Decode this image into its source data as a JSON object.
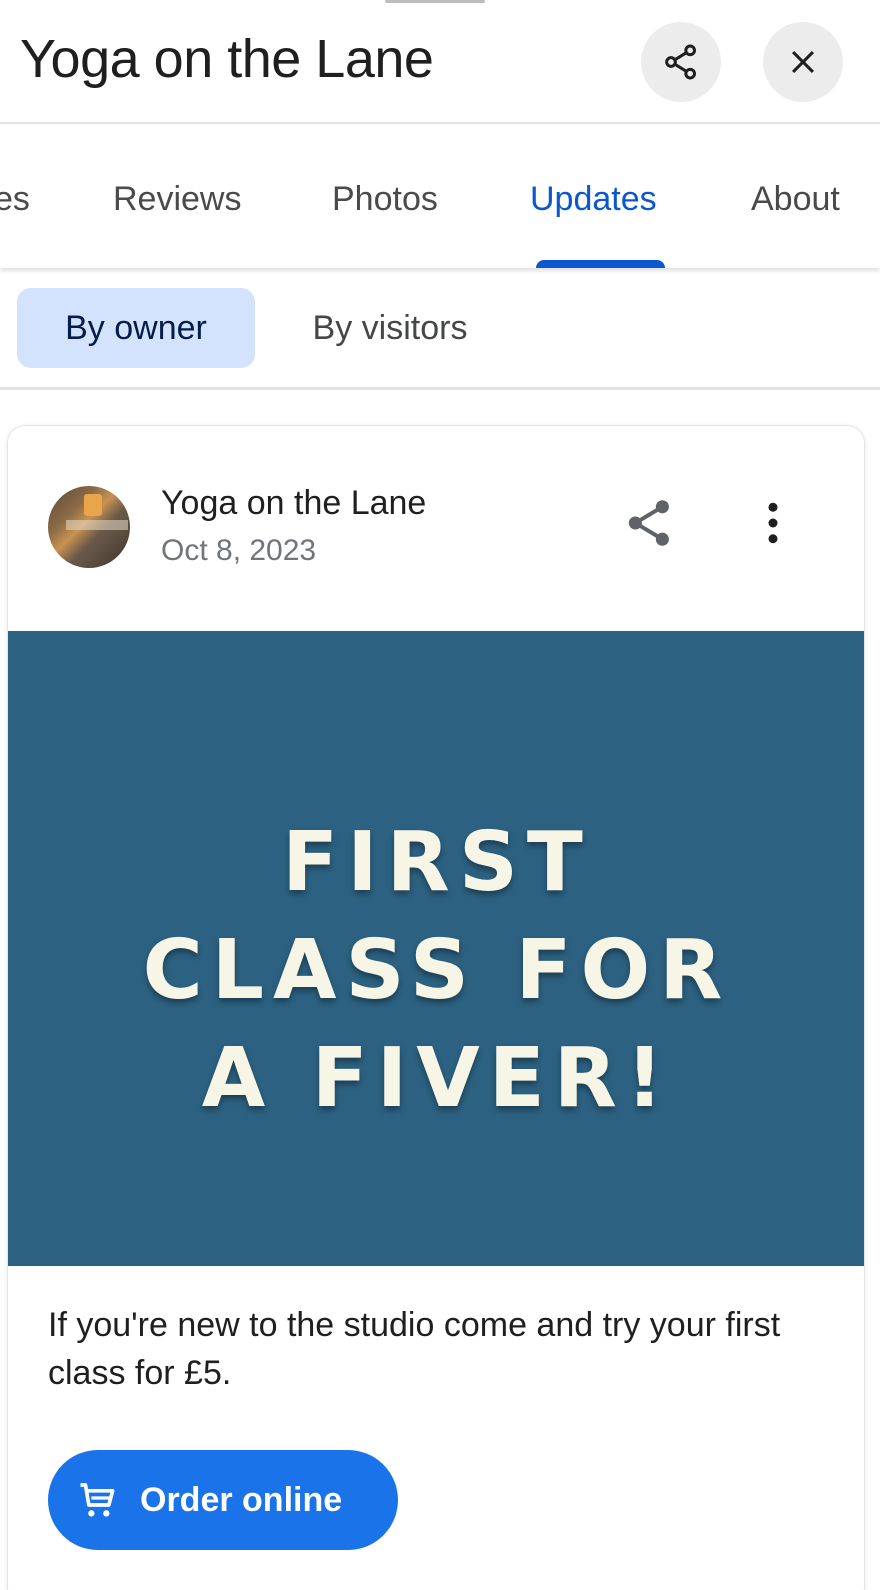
{
  "header": {
    "title": "Yoga on the Lane",
    "share_icon": "share-icon",
    "close_icon": "close-icon"
  },
  "tabs": [
    {
      "label": "es",
      "active": false
    },
    {
      "label": "Reviews",
      "active": false
    },
    {
      "label": "Photos",
      "active": false
    },
    {
      "label": "Updates",
      "active": true
    },
    {
      "label": "About",
      "active": false
    }
  ],
  "filters": {
    "by_owner": "By owner",
    "by_visitors": "By visitors",
    "selected": "By owner"
  },
  "post": {
    "author": "Yoga on the Lane",
    "date": "Oct 8, 2023",
    "banner_lines": [
      "FIRST",
      "CLASS FOR",
      "A FIVER!"
    ],
    "body": "If you're new to the studio come and try your first class for £5.",
    "cta_label": "Order online",
    "cta_icon": "cart-icon"
  },
  "colors": {
    "accent": "#0b57d0",
    "chip_selected_bg": "#d3e3fd",
    "banner_bg": "#2c6181",
    "button_bg": "#1a73e8"
  }
}
